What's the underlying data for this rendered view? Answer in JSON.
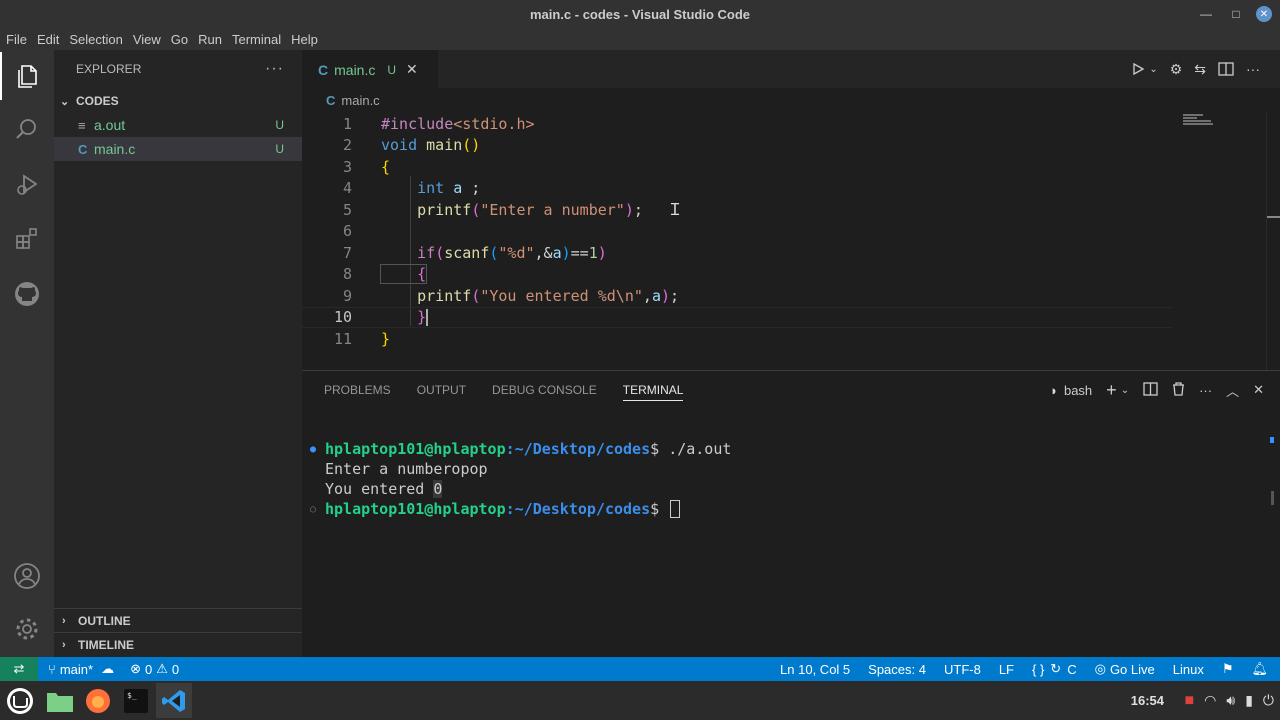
{
  "window": {
    "title": "main.c - codes - Visual Studio Code"
  },
  "menu": [
    "File",
    "Edit",
    "Selection",
    "View",
    "Go",
    "Run",
    "Terminal",
    "Help"
  ],
  "activity_icons": [
    "files-icon",
    "search-icon",
    "run-debug-icon",
    "extensions-icon",
    "github-icon",
    "account-icon",
    "settings-gear-icon"
  ],
  "sidebar": {
    "title": "EXPLORER",
    "more": "···",
    "folder": "CODES",
    "files": [
      {
        "icon": "≡",
        "name": "a.out",
        "status": "U"
      },
      {
        "icon": "C",
        "name": "main.c",
        "status": "U"
      }
    ],
    "outline": "OUTLINE",
    "timeline": "TIMELINE"
  },
  "editor": {
    "tab": {
      "icon": "C",
      "name": "main.c",
      "status": "U",
      "close": "✕"
    },
    "breadcrumb": {
      "icon": "C",
      "file": "main.c"
    },
    "line_numbers": [
      "1",
      "2",
      "3",
      "4",
      "5",
      "6",
      "7",
      "8",
      "9",
      "10",
      "11"
    ],
    "code": {
      "l1a": "#include",
      "l1b": "<stdio.h>",
      "l2a": "void",
      "l2b": " main",
      "l2c": "()",
      "l3a": "{",
      "l4a": "    int",
      "l4b": " a",
      "l4c": " ;",
      "l5a": "    printf",
      "l5b": "(",
      "l5c": "\"Enter a number\"",
      "l5d": ")",
      "l5e": ";",
      "l7a": "    if",
      "l7b": "(",
      "l7c": "scanf",
      "l7d": "(",
      "l7e": "\"%d\"",
      "l7f": ",&",
      "l7g": "a",
      "l7h": ")",
      "l7i": "==",
      "l7j": "1",
      "l7k": ")",
      "l8a": "    {",
      "l9a": "    printf",
      "l9b": "(",
      "l9c": "\"You entered %d\\n\"",
      "l9d": ",",
      "l9e": "a",
      "l9f": ")",
      "l9g": ";",
      "l10a": "    }",
      "l11a": "}"
    }
  },
  "panel": {
    "tabs": [
      "PROBLEMS",
      "OUTPUT",
      "DEBUG CONSOLE",
      "TERMINAL"
    ],
    "shell": "bash",
    "terminal": {
      "user": "hplaptop101@hplaptop",
      "path": ":~/Desktop/codes",
      "prompt_end": "$ ",
      "cmd": "./a.out",
      "out1": "Enter a numberopop",
      "out2a": "You entered ",
      "out2b": "0"
    }
  },
  "status": {
    "branch": "main*",
    "errors": "0",
    "warnings": "0",
    "position": "Ln 10, Col 5",
    "spaces": "Spaces: 4",
    "encoding": "UTF-8",
    "eol": "LF",
    "lang_braces": "{ }",
    "language": "C",
    "golive": "Go Live",
    "os": "Linux"
  },
  "taskbar": {
    "clock": "16:54"
  },
  "colors": {
    "accent": "#007acc",
    "remote": "#16825d",
    "untracked": "#73c991"
  }
}
